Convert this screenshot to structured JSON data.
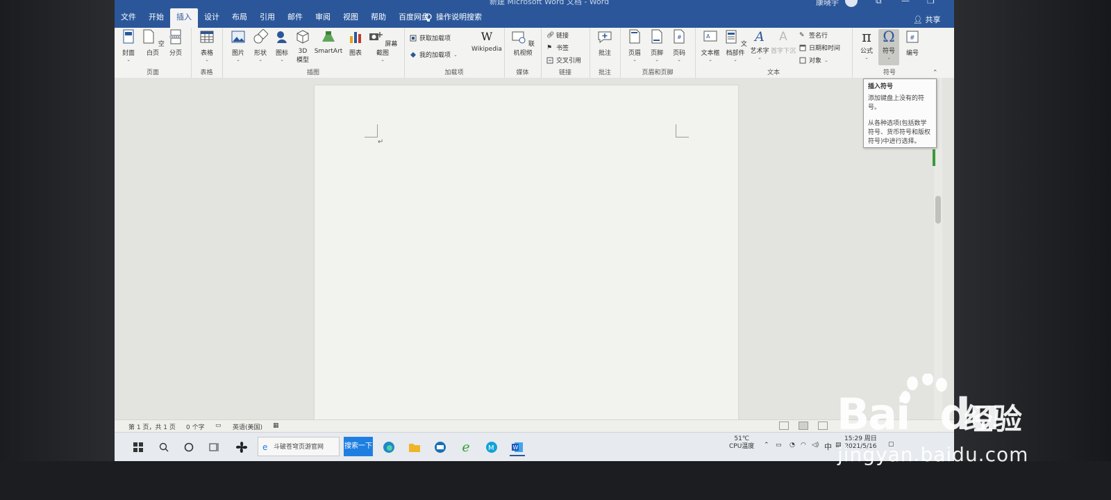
{
  "window": {
    "doc_title": "新建 Microsoft Word 文档 - Word",
    "user": "康晓宇",
    "share": "共享"
  },
  "tabs": [
    "文件",
    "开始",
    "插入",
    "设计",
    "布局",
    "引用",
    "邮件",
    "审阅",
    "视图",
    "帮助",
    "百度网盘"
  ],
  "tell_me": "操作说明搜索",
  "ribbon": {
    "groups": {
      "pages": "页面",
      "tables": "表格",
      "illustrations": "插图",
      "addins": "加载项",
      "media": "媒体",
      "links": "链接",
      "comments": "批注",
      "header_footer": "页眉和页脚",
      "text": "文本",
      "symbols": "符号"
    },
    "buttons": {
      "cover": "封面",
      "blank_page": "空白页",
      "page_break": "分页",
      "table": "表格",
      "pictures": "图片",
      "shapes": "形状",
      "icons": "图标",
      "model3d_1": "3D",
      "model3d_2": "模型",
      "smartart": "SmartArt",
      "chart": "图表",
      "screenshot": "屏幕截图",
      "get_addins": "获取加载项",
      "my_addins": "我的加载项",
      "wikipedia": "Wikipedia",
      "online_video": "联机视频",
      "link": "链接",
      "bookmark": "书签",
      "cross_ref": "交叉引用",
      "comment": "批注",
      "header": "页眉",
      "footer": "页脚",
      "page_number": "页码",
      "text_box": "文本框",
      "quick_parts": "文档部件",
      "wordart": "艺术字",
      "drop_cap": "首字下沉",
      "signature_line": "签名行",
      "date_time": "日期和时间",
      "object": "对象",
      "equation": "公式",
      "symbol": "符号",
      "number": "编号"
    }
  },
  "tooltip": {
    "title": "插入符号",
    "line1": "添加键盘上没有的符号。",
    "line2": "从各种选项(包括数学符号、货币符号和版权符号)中进行选择。"
  },
  "status": {
    "page": "第 1 页，共 1 页",
    "words": "0 个字",
    "language": "英语(美国)"
  },
  "taskbar": {
    "search_text": "斗破苍穹页游官网",
    "search_button": "搜索一下",
    "temp": "51℃",
    "temp_label": "CPU温度",
    "ime": "中",
    "time": "15:29 周日",
    "date": "2021/5/16"
  },
  "watermark": {
    "brand": "Bai",
    "brand2": "du",
    "jingyan": "经验",
    "url": "jingyan.baidu.com"
  },
  "colors": {
    "title_bar": "#2b579a",
    "ribbon": "#f3f3f1",
    "page": "#f2f2ef",
    "search_button": "#1f7fe0"
  }
}
